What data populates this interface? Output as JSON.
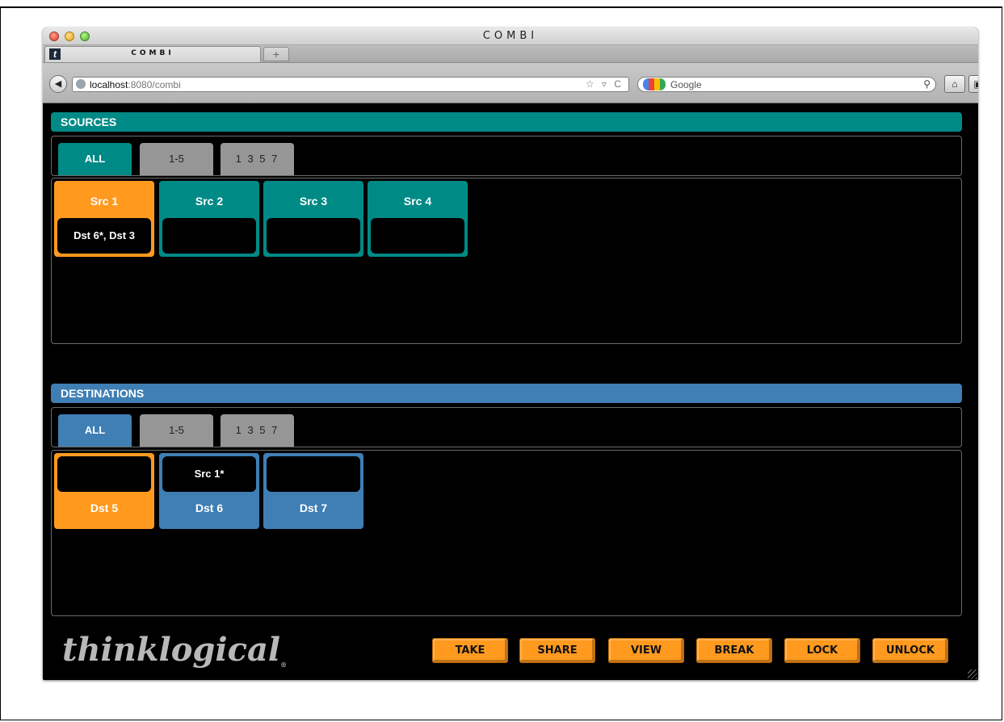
{
  "browser": {
    "window_title": "COMBI",
    "tab_title": "COMBI",
    "tab_favicon": "t",
    "new_tab_label": "+",
    "url_host": "localhost",
    "url_rest": ":8080/combi",
    "address_icons": "☆ ▿ C",
    "search_placeholder": "Google",
    "icons": [
      "back-arrow-icon",
      "globe-icon",
      "star-icon",
      "reload-icon",
      "google-icon",
      "magnifier-icon",
      "home-icon",
      "bookmark-icon"
    ]
  },
  "sources": {
    "header": "SOURCES",
    "tabs": [
      {
        "label": "ALL",
        "active": true
      },
      {
        "label": "1-5",
        "active": false
      },
      {
        "label": "1 3 5 7",
        "active": false
      }
    ],
    "tiles": [
      {
        "label": "Src 1",
        "routes": "Dst 6*, Dst 3",
        "selected": true
      },
      {
        "label": "Src 2",
        "routes": "",
        "selected": false
      },
      {
        "label": "Src 3",
        "routes": "",
        "selected": false
      },
      {
        "label": "Src 4",
        "routes": "",
        "selected": false
      }
    ]
  },
  "destinations": {
    "header": "DESTINATIONS",
    "tabs": [
      {
        "label": "ALL",
        "active": true
      },
      {
        "label": "1-5",
        "active": false
      },
      {
        "label": "1 3 5 7",
        "active": false
      }
    ],
    "tiles": [
      {
        "label": "Dst 5",
        "routes": "",
        "selected": true
      },
      {
        "label": "Dst 6",
        "routes": "Src 1*",
        "selected": false
      },
      {
        "label": "Dst 7",
        "routes": "",
        "selected": false
      }
    ]
  },
  "footer": {
    "logo": "thinklogical",
    "logo_mark": "®",
    "buttons": [
      "TAKE",
      "SHARE",
      "VIEW",
      "BREAK",
      "LOCK",
      "UNLOCK"
    ]
  },
  "colors": {
    "sources_accent": "#008a86",
    "destinations_accent": "#3f7fb4",
    "selected": "#ff9a1f",
    "inactive_tab": "#969696",
    "background": "#000000"
  }
}
